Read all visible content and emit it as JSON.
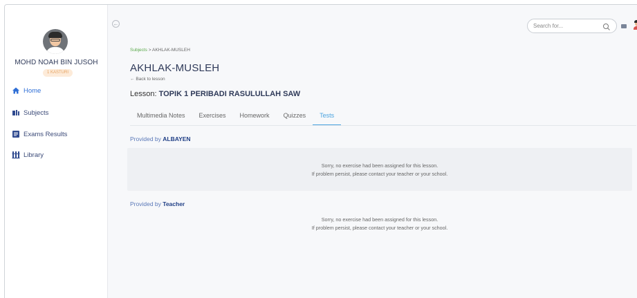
{
  "sidebar": {
    "user_name": "MOHD NOAH BIN JUSOH",
    "user_class": "1 KASTURI",
    "items": [
      {
        "label": "Home",
        "icon": "home-icon"
      },
      {
        "label": "Subjects",
        "icon": "subjects-icon"
      },
      {
        "label": "Exams Results",
        "icon": "exam-results-icon"
      },
      {
        "label": "Library",
        "icon": "library-icon"
      }
    ]
  },
  "header": {
    "search_placeholder": "Search for..."
  },
  "breadcrumb": {
    "root": "Subjects",
    "separator": ">",
    "current": "AKHLAK-MUSLEH"
  },
  "page": {
    "title": "AKHLAK-MUSLEH",
    "back_label": "Back to lesson",
    "lesson_prefix": "Lesson:",
    "lesson_name": "TOPIK 1 PERIBADI RASULULLAH SAW"
  },
  "tabs": [
    {
      "label": "Multimedia Notes",
      "active": false
    },
    {
      "label": "Exercises",
      "active": false
    },
    {
      "label": "Homework",
      "active": false
    },
    {
      "label": "Quizzes",
      "active": false
    },
    {
      "label": "Tests",
      "active": true
    }
  ],
  "sections": [
    {
      "provided_by_prefix": "Provided by",
      "provider": "ALBAYEN",
      "message_line1": "Sorry, no exercise had been assigned for this lesson.",
      "message_line2": "If problem persist, please contact your teacher or your school."
    },
    {
      "provided_by_prefix": "Provided by",
      "provider": "Teacher",
      "message_line1": "Sorry, no exercise had been assigned for this lesson.",
      "message_line2": "If problem persist, please contact your teacher or your school."
    }
  ],
  "colors": {
    "accent": "#4aa3df",
    "nav_text": "#3b4a78",
    "breadcrumb_link": "#5aa94a",
    "badge_bg": "#fdebd9",
    "badge_text": "#e5a261"
  }
}
